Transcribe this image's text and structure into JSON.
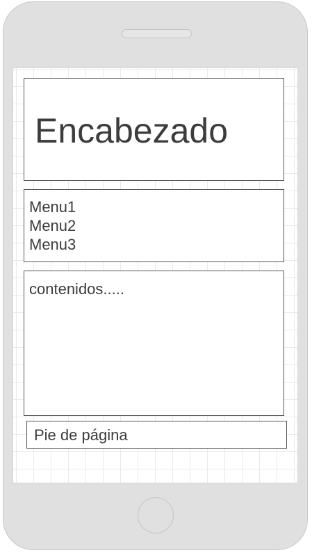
{
  "header": {
    "title": "Encabezado"
  },
  "menu": {
    "items": [
      {
        "label": "Menu1"
      },
      {
        "label": "Menu2"
      },
      {
        "label": "Menu3"
      }
    ]
  },
  "content": {
    "text": "contenidos....."
  },
  "footer": {
    "text": "Pie de página"
  },
  "colors": {
    "device_body": "#e0e0e0",
    "grid_line": "#e9e9e9",
    "box_border": "#555555",
    "text": "#3c3c3c"
  }
}
